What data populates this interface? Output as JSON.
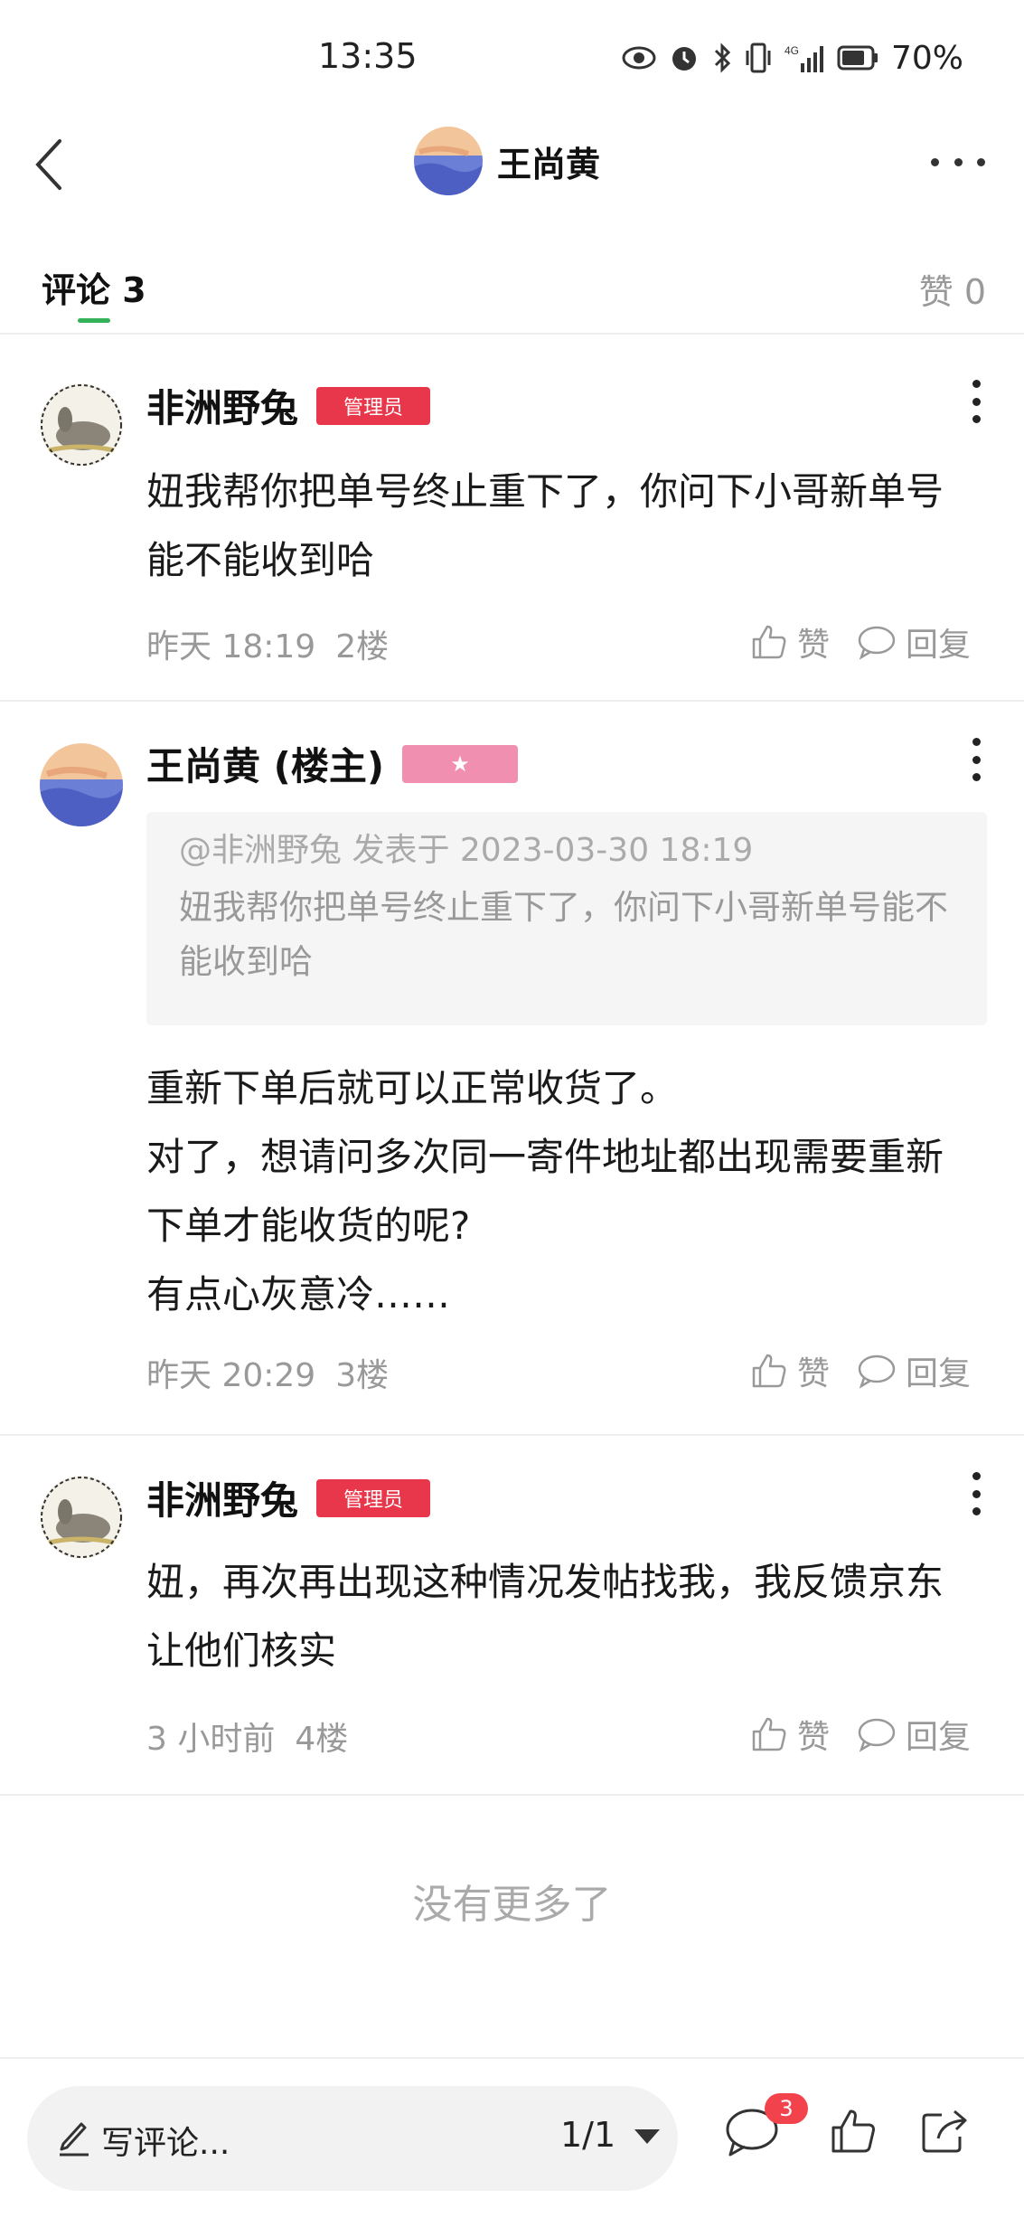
{
  "status_bar": {
    "time": "13:35",
    "battery": "70%",
    "icons": [
      "eye-icon",
      "alarm-icon",
      "bluetooth-icon",
      "vibrate-icon",
      "signal-4g-icon",
      "battery-icon"
    ]
  },
  "nav": {
    "title": "王尚黄"
  },
  "tabs": {
    "comments": "评论 3",
    "likes": "赞 0"
  },
  "comments": [
    {
      "name": "非洲野兔",
      "badge": "管理员",
      "text": "妞我帮你把单号终止重下了，你问下小哥新单号能不能收到哈",
      "time": "昨天 18:19",
      "floor": "2楼",
      "like_label": "赞",
      "reply_label": "回复"
    },
    {
      "name": "王尚黄 (楼主)",
      "badge": "★",
      "quote_meta": "@非洲野兔 发表于 2023-03-30 18:19",
      "quote_text": "妞我帮你把单号终止重下了，你问下小哥新单号能不能收到哈",
      "text_lines": [
        "重新下单后就可以正常收货了。",
        "对了，想请问多次同一寄件地址都出现需要重新下单才能收货的呢?",
        "有点心灰意冷……"
      ],
      "time": "昨天 20:29",
      "floor": "3楼",
      "like_label": "赞",
      "reply_label": "回复"
    },
    {
      "name": "非洲野兔",
      "badge": "管理员",
      "text": "妞，再次再出现这种情况发帖找我，我反馈京东让他们核实",
      "time": "3 小时前",
      "floor": "4楼",
      "like_label": "赞",
      "reply_label": "回复"
    }
  ],
  "footer": {
    "no_more": "没有更多了"
  },
  "bottom_bar": {
    "placeholder": "写评论...",
    "page": "1/1",
    "comment_count": "3"
  },
  "colors": {
    "admin_badge": "#e8364a",
    "op_badge": "#f18fb0",
    "tab_indicator": "#33b25a",
    "notify_badge": "#f2434c"
  }
}
